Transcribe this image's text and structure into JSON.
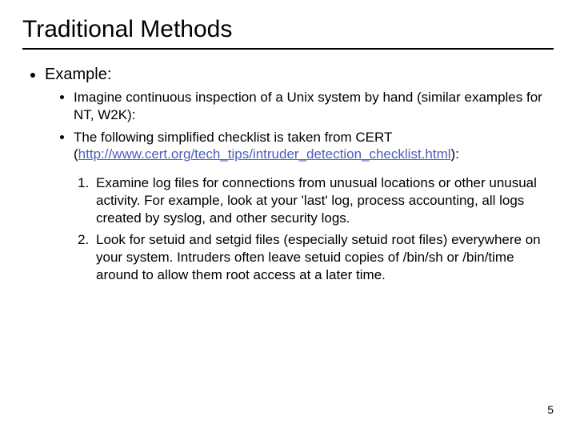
{
  "title": "Traditional Methods",
  "outer_label": "Example:",
  "sub_bullets": [
    "Imagine continuous inspection of a Unix system by hand (similar examples for NT, W2K):",
    "The following simplified checklist is taken from CERT "
  ],
  "link_open": "(",
  "link_text": "http://www.cert.org/tech_tips/intruder_detection_checklist.html",
  "link_close": "):",
  "numbered": [
    "Examine log files for connections from unusual locations or other unusual activity. For example, look at your 'last' log, process accounting, all logs created by syslog, and other security logs.",
    "Look for setuid and setgid files (especially setuid root files) everywhere on your system. Intruders often leave setuid copies of /bin/sh or /bin/time around to allow them root access at a later time."
  ],
  "page_number": "5"
}
